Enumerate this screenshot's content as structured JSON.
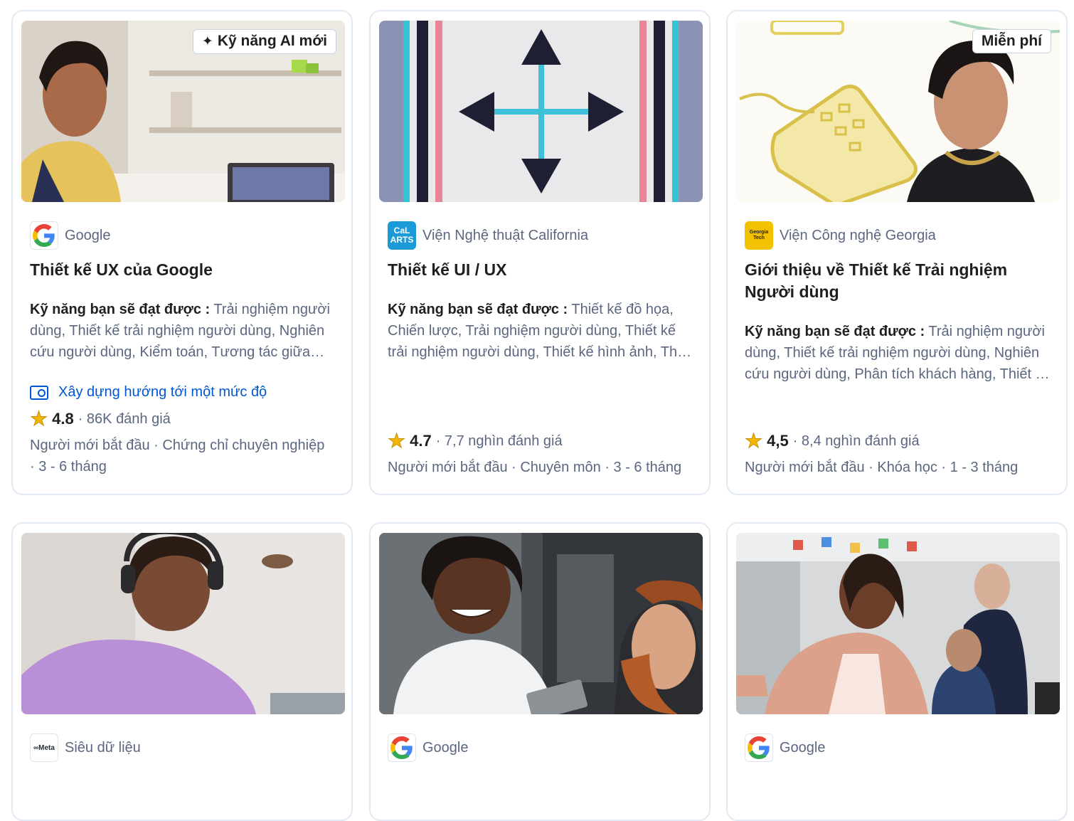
{
  "cards": [
    {
      "badge": "Kỹ năng AI mới",
      "partner": "Google",
      "partner_logo": "google-logo",
      "title": "Thiết kế UX của Google",
      "skills_label": "Kỹ năng bạn sẽ đạt được :",
      "skills": " Trải nghiệm người dùng, Thiết kế trải nghiệm người dùng, Nghiên cứu người dùng, Kiểm toán, Tương tác giữa người và máy tính",
      "degree": "Xây dựng hướng tới một mức độ",
      "rating": "4.8",
      "reviews": "· 86K đánh giá",
      "meta": "Người mới bắt đầu · Chứng chỉ chuyên nghiệp · 3 - 6 tháng"
    },
    {
      "partner": "Viện Nghệ thuật California",
      "partner_logo": "calarts-logo",
      "partner_logo_text": [
        "CaL",
        "ARTS"
      ],
      "title": "Thiết kế UI / UX",
      "skills_label": "Kỹ năng bạn sẽ đạt được :",
      "skills": " Thiết kế đồ họa, Chiến lược, Trải nghiệm người dùng, Thiết kế trải nghiệm người dùng, Thiết kế hình ảnh, Thiết kế tương tác",
      "rating": "4.7",
      "reviews": "· 7,7 nghìn đánh giá",
      "meta": "Người mới bắt đầu · Chuyên môn · 3 - 6 tháng"
    },
    {
      "badge": "Miễn phí",
      "partner": "Viện Công nghệ Georgia",
      "partner_logo": "georgia-tech-logo",
      "partner_logo_text": [
        "Georgia",
        "Tech"
      ],
      "title": "Giới thiệu về Thiết kế Trải nghiệm Người dùng",
      "skills_label": "Kỹ năng bạn sẽ đạt được :",
      "skills": " Trải nghiệm người dùng, Thiết kế trải nghiệm người dùng, Nghiên cứu người dùng, Phân tích khách hàng, Thiết kế tương tác",
      "rating": "4,5",
      "reviews": "· 8,4 nghìn đánh giá",
      "meta": "Người mới bắt đầu · Khóa học · 1 - 3 tháng"
    },
    {
      "partner": "Siêu dữ liệu",
      "partner_logo": "meta-logo",
      "partner_logo_text": "∞Meta"
    },
    {
      "partner": "Google",
      "partner_logo": "google-logo"
    },
    {
      "partner": "Google",
      "partner_logo": "google-logo"
    }
  ],
  "colors": {
    "accent": "#0056d2",
    "star": "#f2b705",
    "border": "#e3eaf4",
    "muted": "#5b6780"
  }
}
